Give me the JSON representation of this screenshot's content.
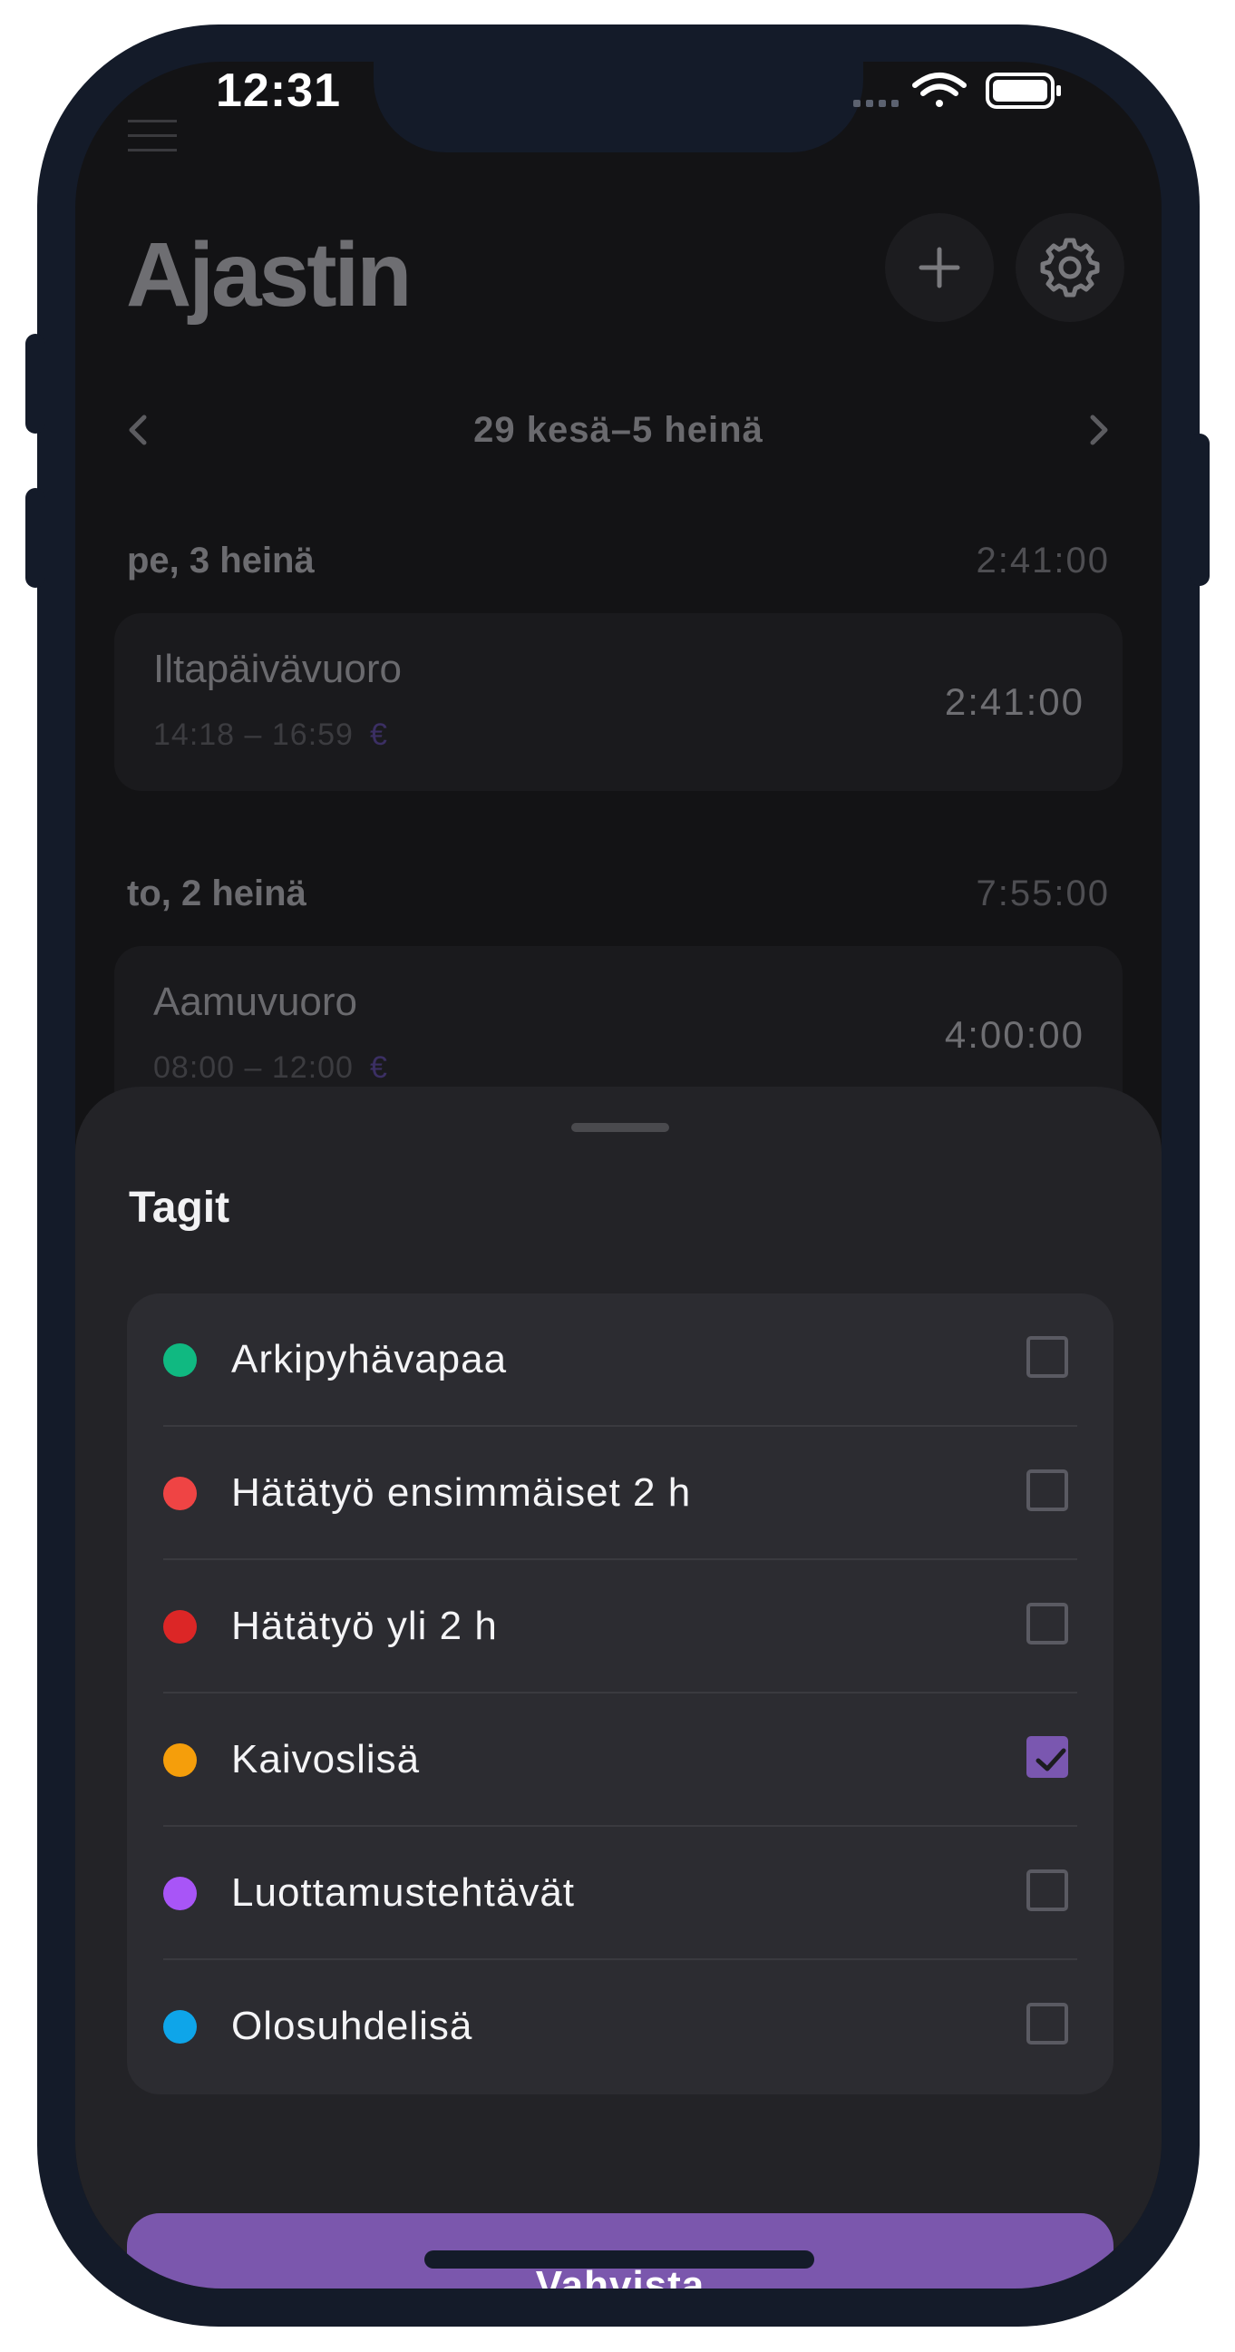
{
  "status_bar": {
    "time": "12:31",
    "icons": [
      "signal-icon",
      "wifi-icon",
      "battery-icon"
    ]
  },
  "header": {
    "menu_icon": "hamburger-icon",
    "title": "Ajastin",
    "add_icon": "plus-icon",
    "settings_icon": "gear-icon"
  },
  "week_nav": {
    "prev_icon": "chevron-left-icon",
    "label": "29 kesä–5 heinä",
    "next_icon": "chevron-right-icon"
  },
  "days": [
    {
      "name": "pe, 3 heinä",
      "total": "2:41:00",
      "entries": [
        {
          "title": "Iltapäivävuoro",
          "time": "14:18 – 16:59",
          "currency": "€",
          "duration": "2:41:00"
        }
      ]
    },
    {
      "name": "to, 2 heinä",
      "total": "7:55:00",
      "entries": [
        {
          "title": "Aamuvuoro",
          "time": "08:00 – 12:00",
          "currency": "€",
          "duration": "4:00:00"
        }
      ]
    }
  ],
  "sheet": {
    "title": "Tagit",
    "tags": [
      {
        "label": "Arkipyhävapaa",
        "color": "#10b981",
        "checked": false
      },
      {
        "label": "Hätätyö ensimmäiset 2 h",
        "color": "#ef4444",
        "checked": false
      },
      {
        "label": "Hätätyö yli 2 h",
        "color": "#dc2626",
        "checked": false
      },
      {
        "label": "Kaivoslisä",
        "color": "#f59e0b",
        "checked": true
      },
      {
        "label": "Luottamustehtävät",
        "color": "#a855f7",
        "checked": false
      },
      {
        "label": "Olosuhdelisä",
        "color": "#0ea5e9",
        "checked": false
      }
    ],
    "confirm_label": "Vahvista"
  },
  "colors": {
    "accent": "#7b57ad",
    "background": "#131315",
    "sheet": "#232327"
  }
}
